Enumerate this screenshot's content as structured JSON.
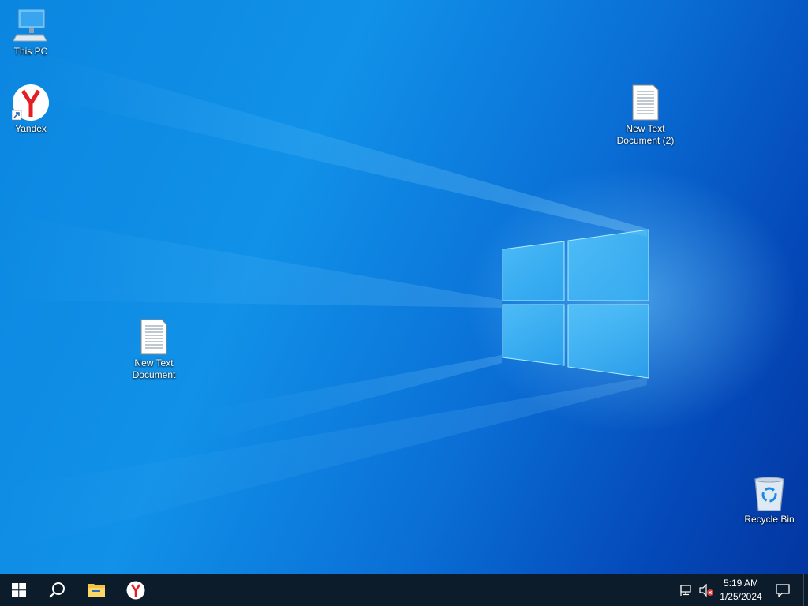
{
  "desktop": {
    "icons": {
      "this_pc": {
        "label": "This PC",
        "icon": "computer-icon"
      },
      "yandex": {
        "label": "Yandex",
        "icon": "yandex-browser-icon"
      },
      "new_text_doc_2": {
        "label_line1": "New Text",
        "label_line2": "Document (2)",
        "icon": "text-document-icon"
      },
      "new_text_doc": {
        "label_line1": "New Text",
        "label_line2": "Document",
        "icon": "text-document-icon"
      },
      "recycle_bin": {
        "label": "Recycle Bin",
        "icon": "recycle-bin-icon"
      }
    },
    "accent": "#0a78dc"
  },
  "taskbar": {
    "start": {
      "icon": "windows-start-icon"
    },
    "search": {
      "icon": "search-icon"
    },
    "pinned": [
      {
        "name": "File Explorer",
        "icon": "folder-icon"
      },
      {
        "name": "Yandex",
        "icon": "yandex-browser-icon"
      }
    ],
    "tray": {
      "network_icon": "network-disconnected-icon",
      "volume_icon": "volume-muted-icon",
      "time": "5:19 AM",
      "date": "1/25/2024",
      "notifications_icon": "action-center-icon"
    },
    "background": "#0c1c2b"
  }
}
